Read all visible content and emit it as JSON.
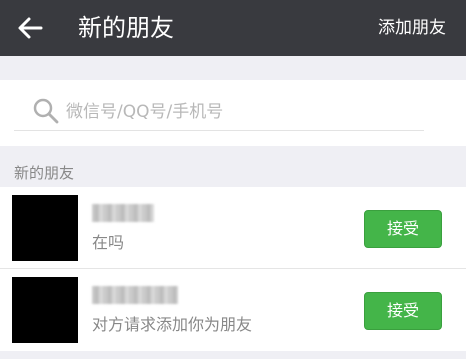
{
  "header": {
    "back_icon": "back-arrow-icon",
    "title": "新的朋友",
    "add_friend_label": "添加朋友"
  },
  "search": {
    "icon": "search-icon",
    "placeholder": "微信号/QQ号/手机号",
    "value": ""
  },
  "section": {
    "label": "新的朋友"
  },
  "requests": [
    {
      "message": "在吗",
      "accept_label": "接受"
    },
    {
      "message": "对方请求添加你为朋友",
      "accept_label": "接受"
    }
  ],
  "colors": {
    "topbar": "#393a3f",
    "accept_button": "#44b549",
    "background": "#efeff4"
  }
}
